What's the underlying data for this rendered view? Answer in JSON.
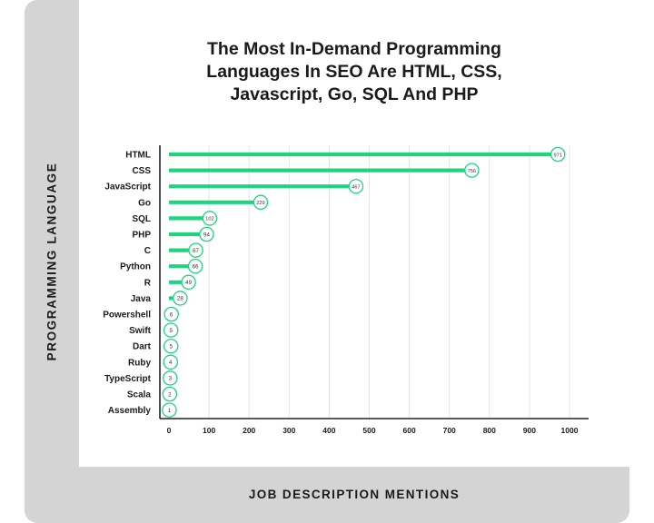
{
  "chart_data": {
    "type": "bar",
    "orientation": "horizontal",
    "title_lines": [
      "The Most In-Demand Programming",
      "Languages In SEO Are HTML, CSS,",
      "Javascript, Go, SQL And PHP"
    ],
    "xlabel": "JOB DESCRIPTION MENTIONS",
    "ylabel": "PROGRAMMING LANGUAGE",
    "categories": [
      "HTML",
      "CSS",
      "JavaScript",
      "Go",
      "SQL",
      "PHP",
      "C",
      "Python",
      "R",
      "Java",
      "Powershell",
      "Swift",
      "Dart",
      "Ruby",
      "TypeScript",
      "Scala",
      "Assembly"
    ],
    "values": [
      971,
      756,
      467,
      229,
      102,
      94,
      67,
      66,
      49,
      28,
      6,
      5,
      5,
      4,
      3,
      2,
      1
    ],
    "xlim": [
      0,
      1000
    ],
    "xticks": [
      0,
      100,
      200,
      300,
      400,
      500,
      600,
      700,
      800,
      900,
      1000
    ],
    "grid": true,
    "colors": {
      "bar": "#1fd37f",
      "text": "#1a1a1a",
      "grid": "#e4e4e4",
      "band": "#d4d4d4"
    }
  }
}
